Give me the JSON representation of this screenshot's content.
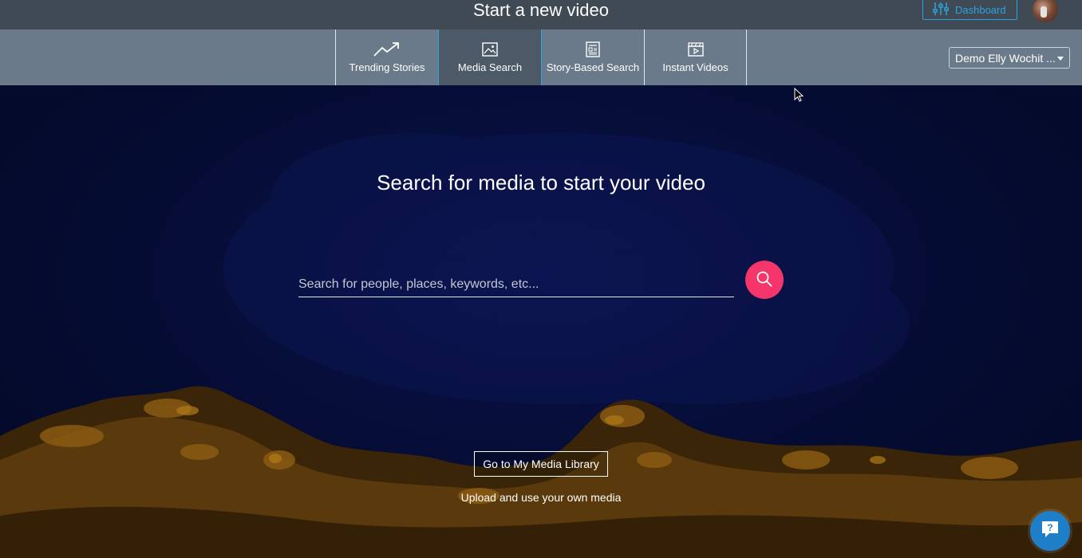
{
  "header": {
    "title": "Start a new video",
    "dashboard_label": "Dashboard"
  },
  "nav": {
    "tabs": [
      {
        "label": "Trending Stories",
        "icon": "trending-icon",
        "active": false
      },
      {
        "label": "Media Search",
        "icon": "image-icon",
        "active": true
      },
      {
        "label": "Story-Based Search",
        "icon": "article-icon",
        "active": false
      },
      {
        "label": "Instant Videos",
        "icon": "clapperboard-icon",
        "active": false
      }
    ],
    "account_selected": "Demo Elly Wochit ..."
  },
  "main": {
    "headline": "Search for media to start your video",
    "search_placeholder": "Search for people, places, keywords, etc...",
    "search_value": "",
    "library_button": "Go to My Media Library",
    "upload_text": "Upload and use your own media"
  },
  "colors": {
    "accent": "#2aa3e0",
    "search_button": "#f4366a",
    "help_button": "#1e7fc8"
  }
}
